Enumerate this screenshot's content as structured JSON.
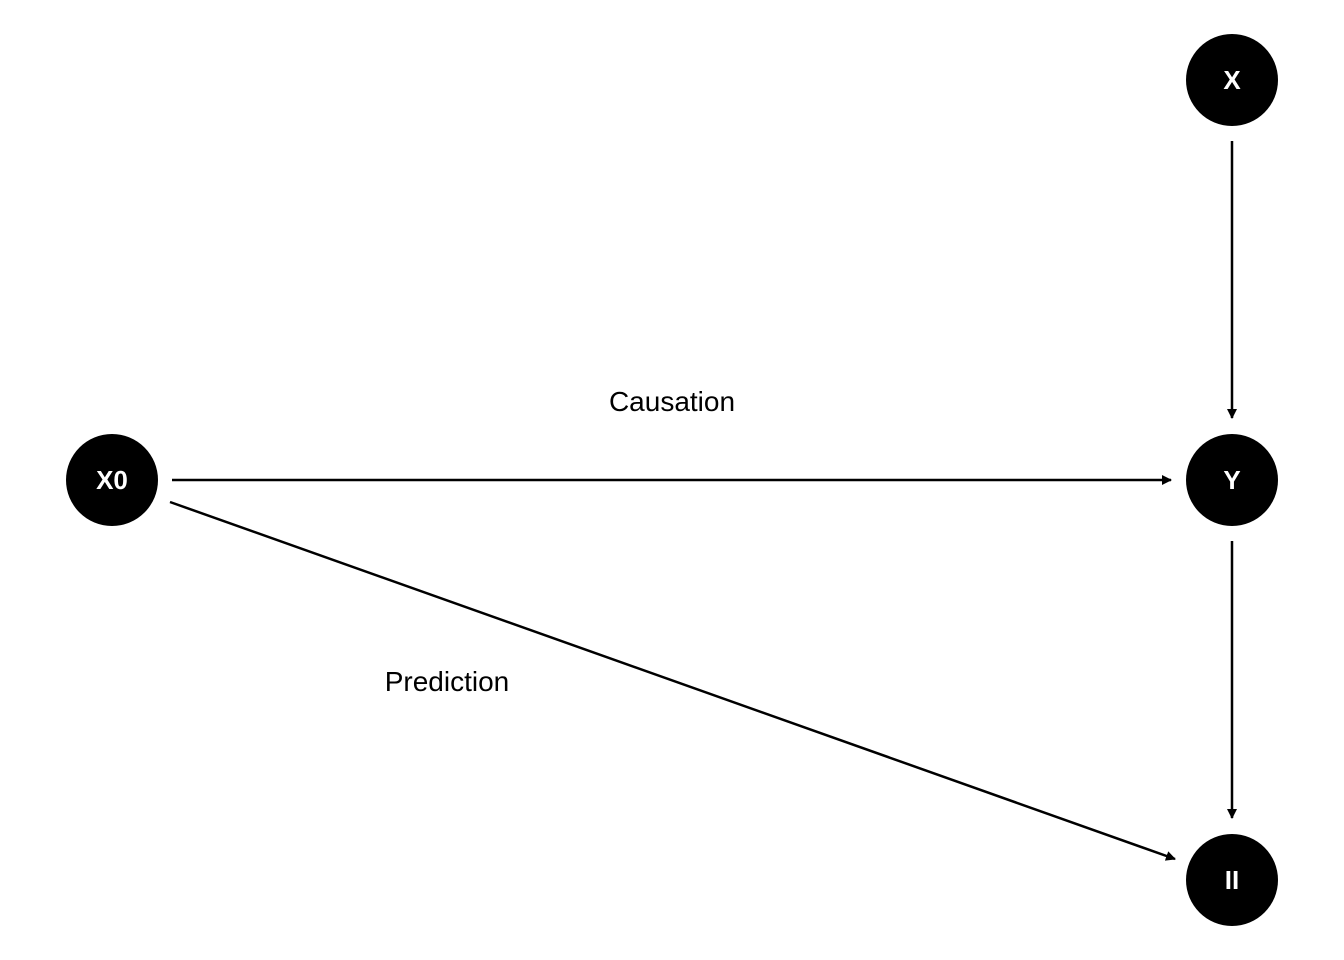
{
  "diagram": {
    "colors": {
      "node_fill": "#000000",
      "node_text": "#ffffff",
      "edge": "#000000",
      "background": "#ffffff"
    },
    "nodes": {
      "x": "X",
      "x0": "X0",
      "y": "Y",
      "ii": "II"
    },
    "edges": {
      "causation": {
        "from": "X0",
        "to": "Y",
        "label": "Causation"
      },
      "prediction": {
        "from": "X0",
        "to": "II",
        "label": "Prediction"
      },
      "x_to_y": {
        "from": "X",
        "to": "Y"
      },
      "y_to_ii": {
        "from": "Y",
        "to": "II"
      }
    }
  }
}
